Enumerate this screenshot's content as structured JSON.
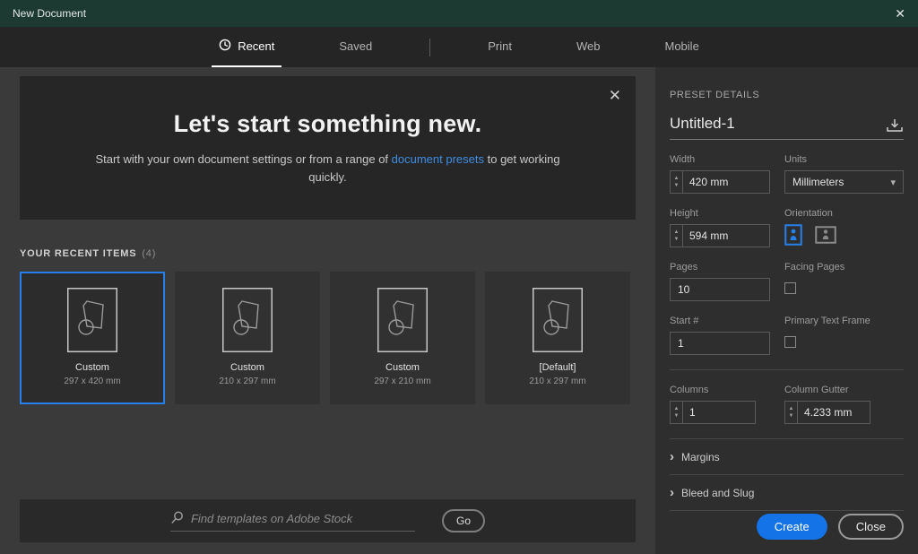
{
  "window": {
    "title": "New Document"
  },
  "icons": {
    "close": "✕",
    "chevron_down": "▾",
    "chevron_right": "›",
    "up": "▲",
    "down": "▼"
  },
  "tabs": [
    {
      "label": "Recent",
      "active": true
    },
    {
      "label": "Saved",
      "active": false
    },
    {
      "label": "Print",
      "active": false
    },
    {
      "label": "Web",
      "active": false
    },
    {
      "label": "Mobile",
      "active": false
    }
  ],
  "hero": {
    "title": "Let's start something new.",
    "subtitle_before": "Start with your own document settings or from a range of ",
    "link": "document presets",
    "subtitle_after": " to get working quickly."
  },
  "recent": {
    "heading": "YOUR RECENT ITEMS",
    "count": "(4)",
    "items": [
      {
        "name": "Custom",
        "size": "297 x 420 mm",
        "selected": true
      },
      {
        "name": "Custom",
        "size": "210 x 297 mm",
        "selected": false
      },
      {
        "name": "Custom",
        "size": "297 x 210 mm",
        "selected": false
      },
      {
        "name": "[Default]",
        "size": "210 x 297 mm",
        "selected": false
      }
    ]
  },
  "search": {
    "placeholder": "Find templates on Adobe Stock",
    "go_label": "Go"
  },
  "preset_details": {
    "heading": "PRESET DETAILS",
    "name_value": "Untitled-1",
    "width": {
      "label": "Width",
      "value": "420 mm"
    },
    "units": {
      "label": "Units",
      "value": "Millimeters"
    },
    "height": {
      "label": "Height",
      "value": "594 mm"
    },
    "orientation": {
      "label": "Orientation"
    },
    "pages": {
      "label": "Pages",
      "value": "10"
    },
    "facing_pages": {
      "label": "Facing Pages",
      "checked": false
    },
    "start": {
      "label": "Start #",
      "value": "1"
    },
    "primary_text_frame": {
      "label": "Primary Text Frame",
      "checked": false
    },
    "columns": {
      "label": "Columns",
      "value": "1"
    },
    "column_gutter": {
      "label": "Column Gutter",
      "value": "4.233 mm"
    },
    "margins_label": "Margins",
    "bleed_slug_label": "Bleed and Slug",
    "create_label": "Create",
    "close_label": "Close"
  },
  "colors": {
    "titlebar": "#1c3a31",
    "accent": "#1473e6",
    "selected_border": "#2680eb",
    "link": "#3f8de0"
  }
}
